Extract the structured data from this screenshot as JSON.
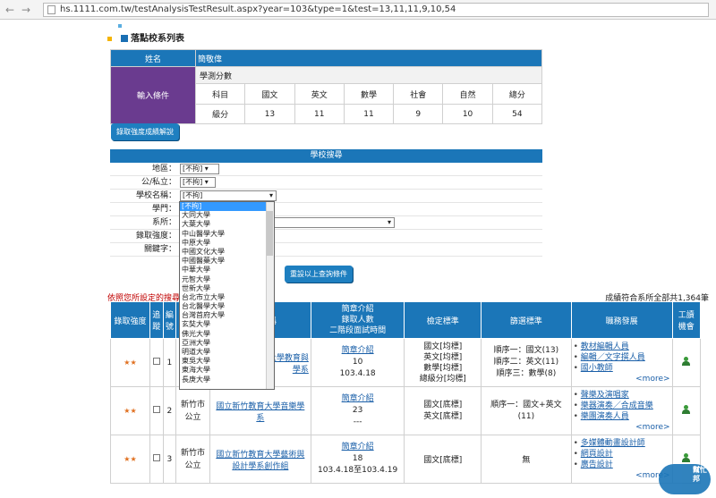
{
  "browser": {
    "url": "hs.1111.com.tw/testAnalysisTestResult.aspx?year=103&type=1&test=13,11,11,9,10,54"
  },
  "header": {
    "title": "落點校系列表"
  },
  "input": {
    "name_label": "姓名",
    "name_value": "簡敬偉",
    "cond_label": "輸入條件",
    "exam_label": "學測分數",
    "row_subject": "科目",
    "row_grade": "級分",
    "subjects": [
      "國文",
      "英文",
      "數學",
      "社會",
      "自然",
      "總分"
    ],
    "grades": [
      "13",
      "11",
      "11",
      "9",
      "10",
      "54"
    ]
  },
  "buttons": {
    "explain": "錄取強度成績解說",
    "reset": "重設以上查詢條件"
  },
  "search": {
    "title": "學校搜尋",
    "rows": [
      {
        "label": "地區：",
        "value": "[不拘]"
      },
      {
        "label": "公/私立：",
        "value": "[不拘]"
      },
      {
        "label": "學校名稱：",
        "value": "[不拘]"
      },
      {
        "label": "學門：",
        "value": ""
      },
      {
        "label": "系所：",
        "value": ""
      },
      {
        "label": "錄取強度：",
        "value": ""
      },
      {
        "label": "關鍵字：",
        "value": ""
      }
    ]
  },
  "dropdown": [
    "[不拘]",
    "大同大學",
    "大葉大學",
    "中山醫學大學",
    "中原大學",
    "中國文化大學",
    "中國醫藥大學",
    "中華大學",
    "元智大學",
    "世新大學",
    "台北市立大學",
    "台北醫學大學",
    "台灣首府大學",
    "玄奘大學",
    "佛光大學",
    "亞洲大學",
    "明道大學",
    "東吳大學",
    "東海大學",
    "長庚大學"
  ],
  "results": {
    "note": "依照您所設定的搜尋",
    "count": "成績符合系所全部共1,364筆",
    "headers": [
      "錄取強度",
      "追蹤",
      "編號",
      "學校",
      "系所名稱",
      "簡章介紹\n錄取人數\n二階段面試時間",
      "檢定標準",
      "篩選標準",
      "職務發展",
      "工讀機會"
    ],
    "rows": [
      {
        "stars": "★★",
        "no": "1",
        "city": "",
        "school": "",
        "dept_a": "大學教育與",
        "dept_b": "學系",
        "brief": "簡章介紹",
        "people": "10",
        "date": "103.4.18",
        "check": [
          "國文[均標]",
          "英文[均標]",
          "數學[均標]",
          "總級分[均標]"
        ],
        "filter": [
          "順序一：國文(13)",
          "順序二：英文(11)",
          "順序三：數學(8)"
        ],
        "jobs": [
          "教材編輯人員",
          "編輯／文字撰人員",
          "國小教師"
        ],
        "more": "<more>"
      },
      {
        "stars": "★★",
        "no": "2",
        "city": "新竹市",
        "school": "公立",
        "dept_a": "國立新竹教育大學音樂學",
        "dept_b": "系",
        "brief": "簡章介紹",
        "people": "23",
        "date": "---",
        "check": [
          "國文[底標]",
          "英文[底標]"
        ],
        "filter": [
          "順序一：國文+英文",
          "(11)"
        ],
        "jobs": [
          "聲樂及演唱家",
          "樂器演奏／合成音樂",
          "樂團演奏人員"
        ],
        "more": "<more>"
      },
      {
        "stars": "★★",
        "no": "3",
        "city": "新竹市",
        "school": "公立",
        "dept_a": "國立新竹教育大學藝術與",
        "dept_b": "設計學系創作組",
        "brief": "簡章介紹",
        "people": "18",
        "date": "103.4.18至103.4.19",
        "check": [
          "國文[底標]"
        ],
        "filter": [
          "無"
        ],
        "jobs": [
          "多媒體動畫設計師",
          "網頁設計",
          "廣告設計"
        ],
        "more": "<more>"
      }
    ]
  },
  "watermark": {
    "main": "IT邦",
    "sub": "幫忙"
  }
}
